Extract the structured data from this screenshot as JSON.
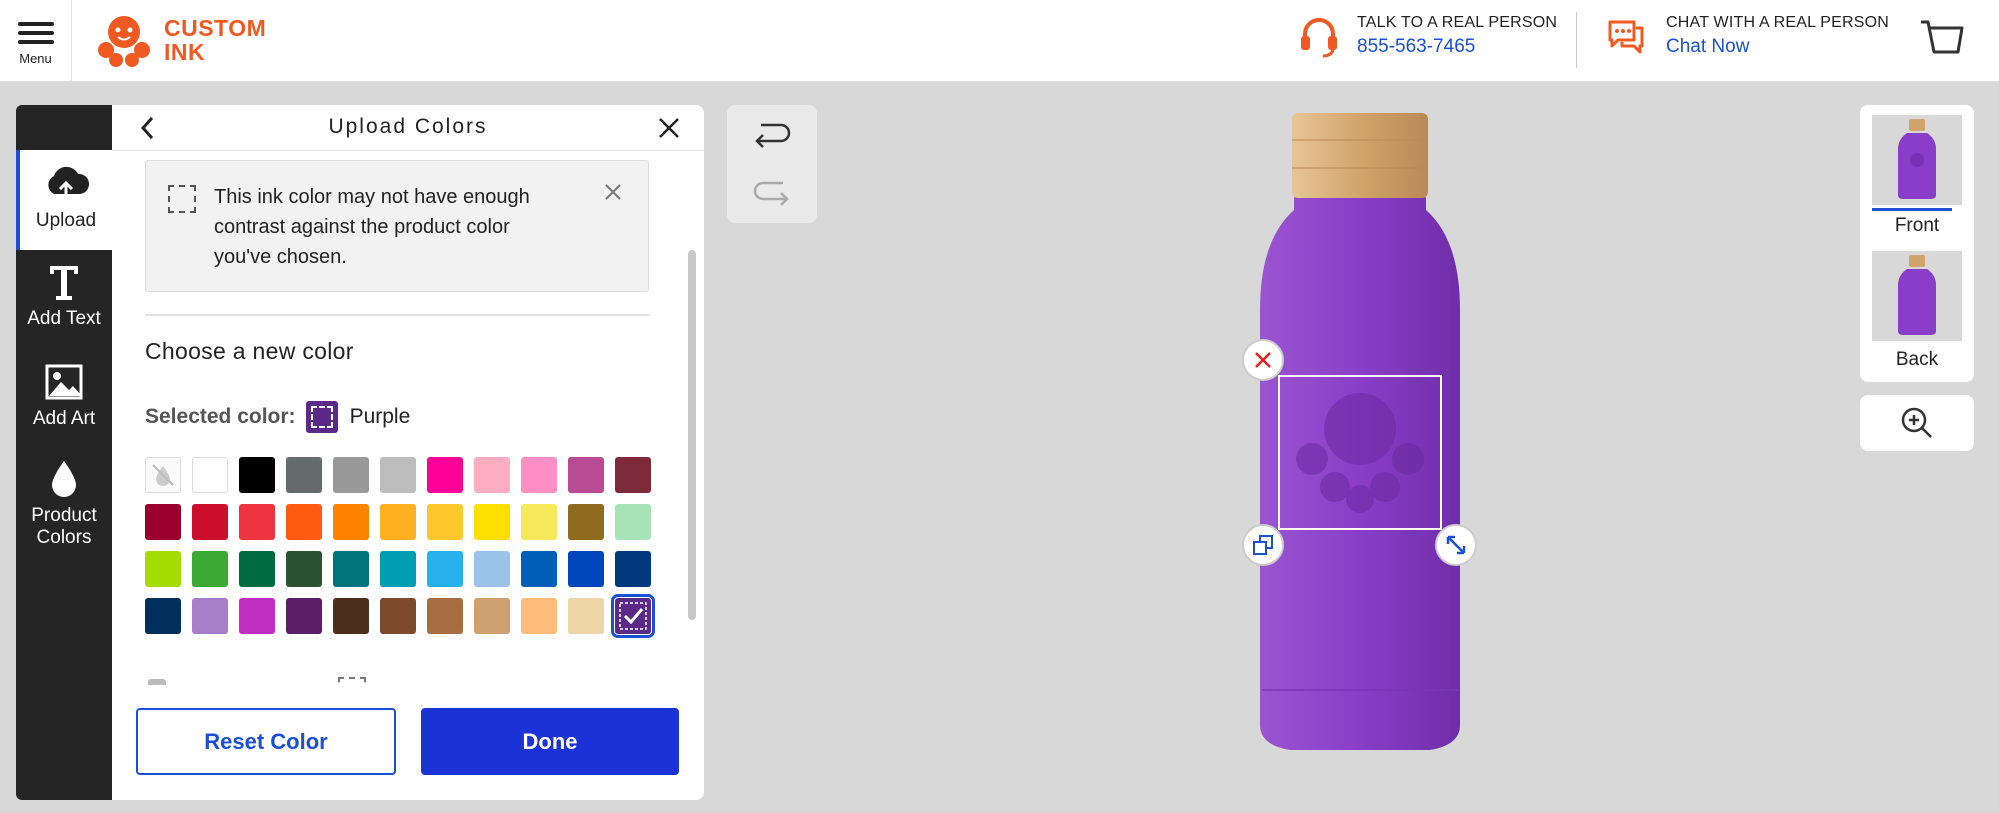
{
  "header": {
    "menu_label": "Menu",
    "logo_line1": "CUSTOM",
    "logo_line2": "INK",
    "talk_label": "TALK TO A REAL PERSON",
    "talk_phone": "855-563-7465",
    "chat_label": "CHAT WITH A REAL PERSON",
    "chat_link": "Chat Now",
    "accent_color": "#f05a22",
    "link_color": "#1a4fd6"
  },
  "sidebar": {
    "items": [
      {
        "label": "Upload",
        "icon": "cloud-upload-icon",
        "active": true
      },
      {
        "label": "Add Text",
        "icon": "text-icon",
        "active": false
      },
      {
        "label": "Add Art",
        "icon": "image-icon",
        "active": false
      },
      {
        "label": "Product Colors",
        "icon": "droplet-icon",
        "active": false
      }
    ]
  },
  "panel": {
    "title": "Upload Colors",
    "warning": "This ink color may not have enough contrast against the product color you've chosen.",
    "choose_heading": "Choose a new color",
    "selected_label": "Selected color:",
    "selected_value": "Purple",
    "selected_hex": "#5b2a86",
    "swatches": [
      "none",
      "#ffffff",
      "#000000",
      "#636b6b",
      "#999999",
      "#bdbdbd",
      "#ff0099",
      "#ffadc3",
      "#ff8ec5",
      "#b94b94",
      "#7f2a3b",
      "#9b002f",
      "#cc0e2d",
      "#ef3340",
      "#ff5a12",
      "#ff8200",
      "#ffb020",
      "#ffc72c",
      "#ffdf00",
      "#f7e859",
      "#8f6b20",
      "#a6e3b7",
      "#a4db00",
      "#3aaa35",
      "#006b3f",
      "#2c5234",
      "#00747a",
      "#009eb2",
      "#27b1ea",
      "#9ac3e9",
      "#005eb8",
      "#0047bb",
      "#003a7d",
      "#002f5a",
      "#a77fc9",
      "#c02ec2",
      "#5b1f69",
      "#4b2e1c",
      "#7c4a2a",
      "#a76d40",
      "#d0a170",
      "#ffbd7b",
      "#eed5a7",
      "#5b2a86"
    ],
    "selected_index": 43,
    "reset_label": "Reset Color",
    "done_label": "Done"
  },
  "views": {
    "front_label": "Front",
    "back_label": "Back",
    "active": "Front"
  },
  "product": {
    "color": "#8a3dc8",
    "cap_color": "#d2a46c"
  }
}
